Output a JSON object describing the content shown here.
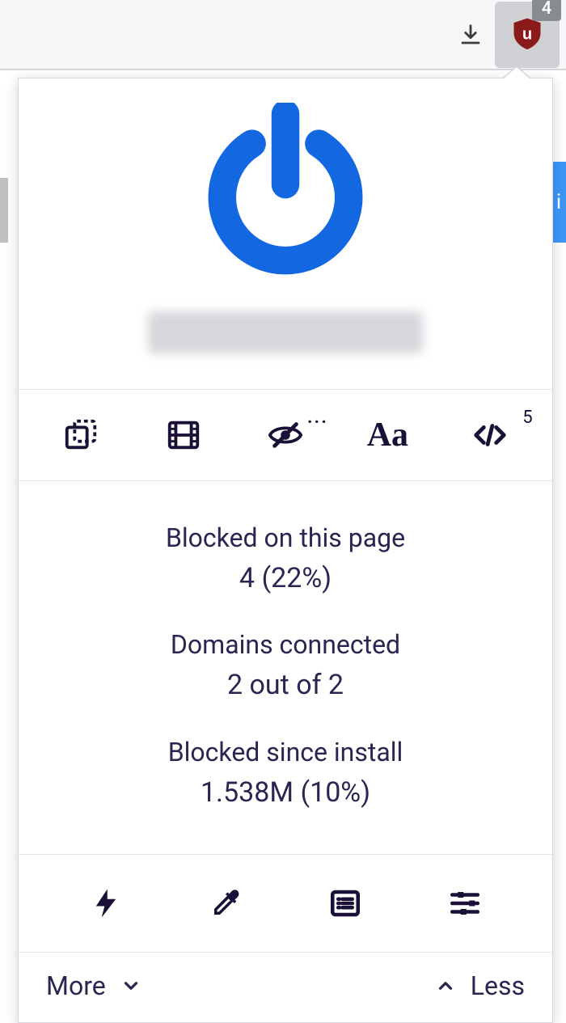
{
  "browser": {
    "extension_badge": "4"
  },
  "popup": {
    "toolbar": {
      "scripts_count": "5"
    },
    "stats": {
      "blocked_page_label": "Blocked on this page",
      "blocked_page_value": "4 (22%)",
      "domains_label": "Domains connected",
      "domains_value": "2 out of 2",
      "blocked_install_label": "Blocked since install",
      "blocked_install_value": "1.538M (10%)"
    },
    "footer": {
      "more_label": "More",
      "less_label": "Less"
    }
  }
}
